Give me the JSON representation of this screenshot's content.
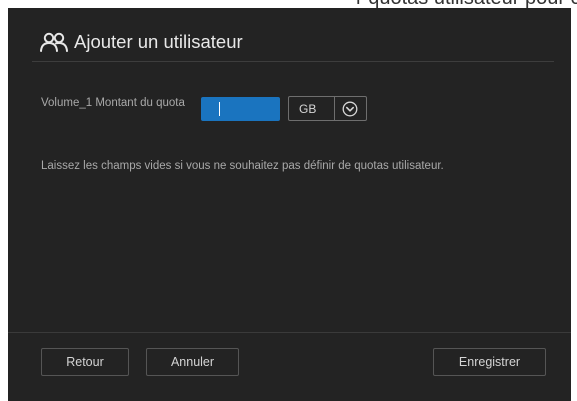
{
  "background_hint": {
    "text": "r quotas utilisateur pour ce nouvel utilisateur"
  },
  "dialog": {
    "title": "Ajouter un utilisateur",
    "title_icon": "users-icon"
  },
  "quota": {
    "label": "Volume_1 Montant du quota",
    "value": "",
    "unit": "GB",
    "unit_dropdown_icon": "chevron-down-circle-icon"
  },
  "hint": "Laissez les champs vides si vous ne souhaitez pas définir de quotas utilisateur.",
  "buttons": {
    "back": "Retour",
    "cancel": "Annuler",
    "save": "Enregistrer"
  },
  "colors": {
    "dialog_background": "#232323",
    "accent_input": "#1a74bf",
    "text_primary": "#e8e8e8",
    "text_secondary": "#a9a9a9",
    "border": "#555555"
  }
}
